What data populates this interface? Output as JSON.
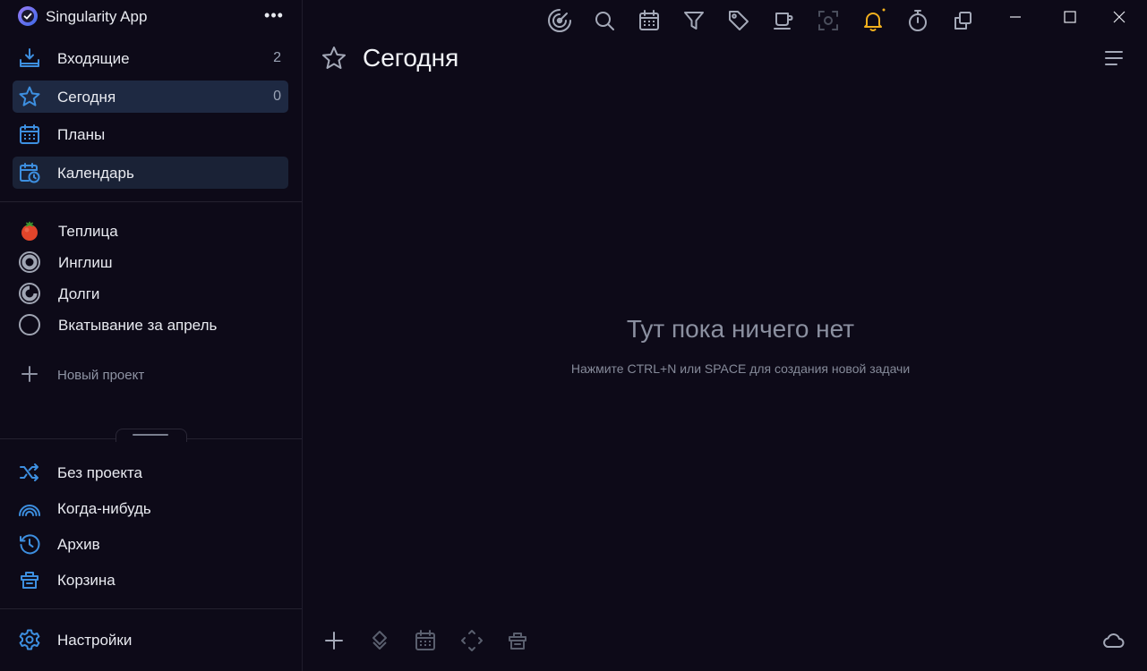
{
  "app": {
    "title": "Singularity App",
    "menu_label": "•••"
  },
  "sidebar": {
    "nav": [
      {
        "label": "Входящие",
        "count": "2"
      },
      {
        "label": "Сегодня",
        "count": "0"
      },
      {
        "label": "Планы"
      },
      {
        "label": "Календарь"
      }
    ],
    "projects": [
      {
        "label": "Теплица",
        "icon": "tomato-icon"
      },
      {
        "label": "Инглиш",
        "icon": "progress-ring-icon"
      },
      {
        "label": "Долги",
        "icon": "progress-ring-icon"
      },
      {
        "label": "Вкатывание за апрель",
        "icon": "circle-icon"
      }
    ],
    "new_project_label": "Новый проект",
    "extra": [
      {
        "label": "Без проекта",
        "icon": "shuffle-icon"
      },
      {
        "label": "Когда-нибудь",
        "icon": "rainbow-icon"
      },
      {
        "label": "Архив",
        "icon": "history-icon"
      },
      {
        "label": "Корзина",
        "icon": "trash-icon"
      }
    ],
    "settings_label": "Настройки"
  },
  "main": {
    "title": "Сегодня",
    "empty_title": "Тут пока ничего нет",
    "empty_hint": "Нажмите CTRL+N или SPACE для создания новой задачи"
  },
  "colors": {
    "background": "#0d0a18",
    "accent": "#3d8fe0",
    "active_item": "#1e2942",
    "notification": "#f2b01e"
  }
}
